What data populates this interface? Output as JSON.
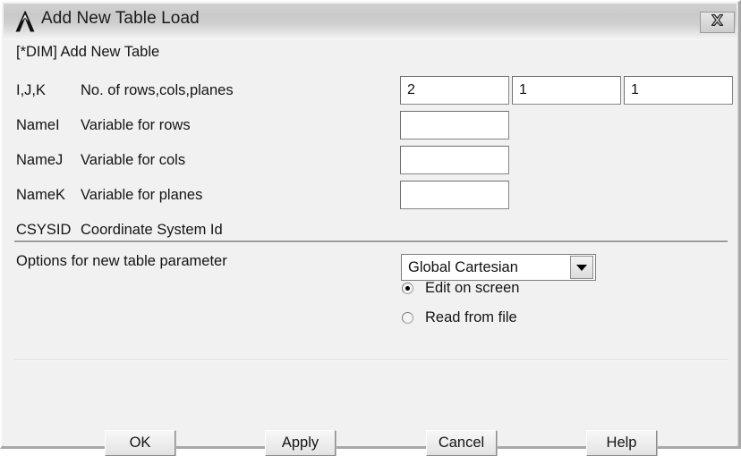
{
  "window": {
    "title": "Add New Table Load",
    "logo_icon": "ansys-logo-icon",
    "close_icon": "close-icon"
  },
  "form": {
    "heading": "[*DIM] Add New Table",
    "rows": [
      {
        "key": "I,J,K",
        "desc": "No. of rows,cols,planes"
      },
      {
        "key": "NameI",
        "desc": "Variable for rows"
      },
      {
        "key": "NameJ",
        "desc": "Variable for cols"
      },
      {
        "key": "NameK",
        "desc": "Variable for planes"
      },
      {
        "key": "CSYSID",
        "desc": "Coordinate System Id"
      }
    ],
    "dims": {
      "i_value": "2",
      "j_value": "1",
      "k_value": "1",
      "placeholder": ""
    },
    "name_i_value": "",
    "name_j_value": "",
    "name_k_value": "",
    "csysid": {
      "selected": "Global Cartesian",
      "arrow_icon": "chevron-down-icon"
    }
  },
  "options": {
    "heading": "Options for new table parameter",
    "radios": [
      {
        "label": "Edit on screen",
        "checked": true
      },
      {
        "label": "Read from file",
        "checked": false
      }
    ]
  },
  "buttons": {
    "ok": "OK",
    "apply": "Apply",
    "cancel": "Cancel",
    "help": "Help"
  }
}
